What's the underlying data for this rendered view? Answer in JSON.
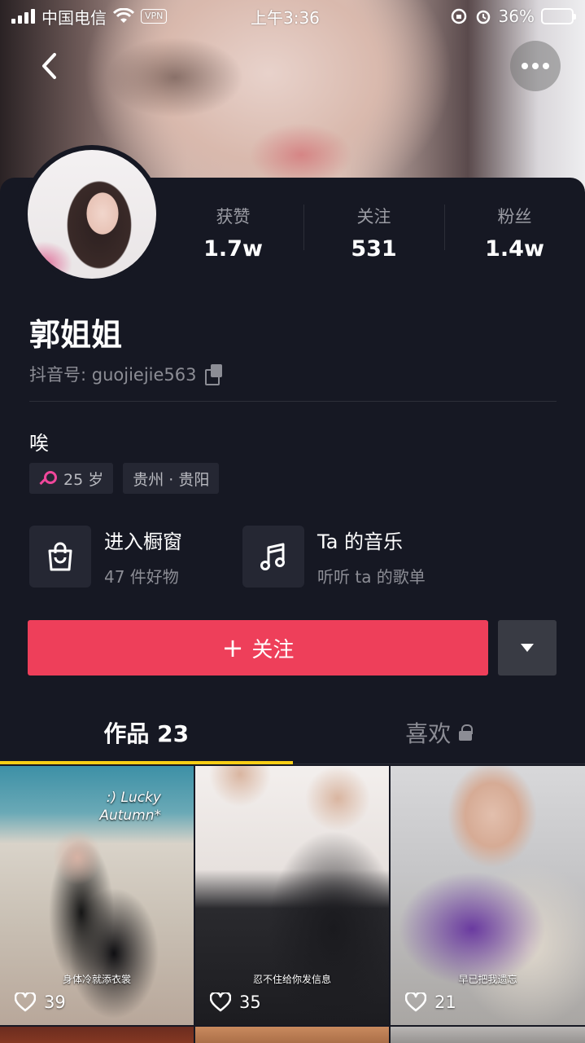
{
  "status_bar": {
    "carrier": "中国电信",
    "vpn": "VPN",
    "time": "上午3:36",
    "battery": "36%",
    "battery_level": 0.36
  },
  "header": {
    "back_icon": "chevron-left-icon",
    "more_icon": "more-horizontal-icon"
  },
  "stats": [
    {
      "label": "获赞",
      "value": "1.7w"
    },
    {
      "label": "关注",
      "value": "531"
    },
    {
      "label": "粉丝",
      "value": "1.4w"
    }
  ],
  "profile": {
    "nickname": "郭姐姐",
    "douyin_id": "抖音号: guojiejie563",
    "bio": "唉",
    "tags": {
      "age": "25 岁",
      "location": "贵州 · 贵阳"
    }
  },
  "shortcuts": [
    {
      "icon": "shopping-bag-icon",
      "title": "进入橱窗",
      "subtitle": "47 件好物"
    },
    {
      "icon": "music-note-icon",
      "title": "Ta 的音乐",
      "subtitle": "听听 ta 的歌单"
    }
  ],
  "actions": {
    "follow_plus": "+",
    "follow_label": "关注",
    "follow_color": "#ee3f5a"
  },
  "tabs": [
    {
      "label": "作品 23",
      "active": true
    },
    {
      "label": "喜欢",
      "active": false,
      "locked": true
    }
  ],
  "accent_color": "#face15",
  "videos": [
    {
      "overlay_title": ":) Lucky",
      "overlay_title2": "Autumn*",
      "caption": "身体冷就添衣裳",
      "likes": "39"
    },
    {
      "caption": "忍不住给你发信息",
      "likes": "35"
    },
    {
      "caption": "早已把我遗忘",
      "likes": "21"
    }
  ]
}
